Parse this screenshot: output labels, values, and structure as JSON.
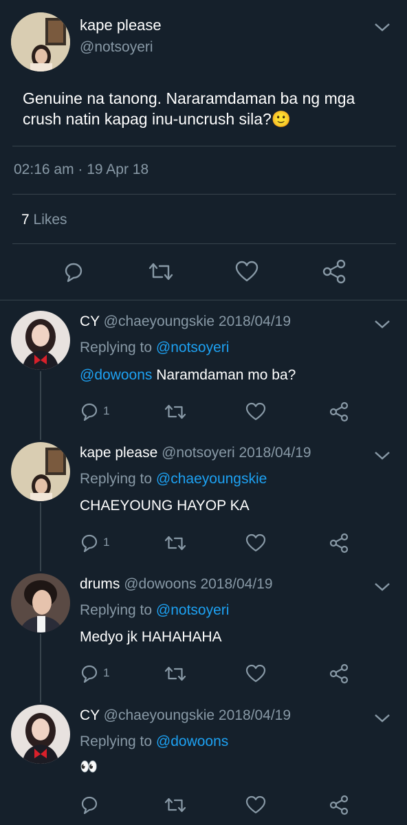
{
  "main_tweet": {
    "display_name": "kape please",
    "handle": "@notsoyeri",
    "text": "Genuine na tanong. Nararamdaman ba ng mga crush natin kapag inu-uncrush sila?🙂",
    "time": "02:16 am",
    "date": "19 Apr 18",
    "meta_sep": "·",
    "likes_count": "7",
    "likes_label": "Likes"
  },
  "replies": [
    {
      "display_name": "CY",
      "handle": "@chaeyoungskie",
      "date": "2018/04/19",
      "replying_label": "Replying to",
      "replying_to": "@notsoyeri",
      "mention": "@dowoons",
      "text": "Naramdaman mo ba?",
      "reply_count": "1"
    },
    {
      "display_name": "kape please",
      "handle": "@notsoyeri",
      "date": "2018/04/19",
      "replying_label": "Replying to",
      "replying_to": "@chaeyoungskie",
      "mention": "",
      "text": "CHAEYOUNG HAYOP KA",
      "reply_count": "1"
    },
    {
      "display_name": "drums",
      "handle": "@dowoons",
      "date": "2018/04/19",
      "replying_label": "Replying to",
      "replying_to": "@notsoyeri",
      "mention": "",
      "text": "Medyo jk HAHAHAHA",
      "reply_count": "1"
    },
    {
      "display_name": "CY",
      "handle": "@chaeyoungskie",
      "date": "2018/04/19",
      "replying_label": "Replying to",
      "replying_to": "@dowoons",
      "mention": "",
      "text": "👀",
      "reply_count": ""
    }
  ],
  "icons": {
    "reply": "reply-icon",
    "retweet": "retweet-icon",
    "like": "heart-icon",
    "share": "share-icon",
    "more": "chevron-down-icon"
  },
  "colors": {
    "background": "#15202b",
    "link": "#1da1f2",
    "muted": "#8899a6",
    "divider": "#38444d"
  }
}
